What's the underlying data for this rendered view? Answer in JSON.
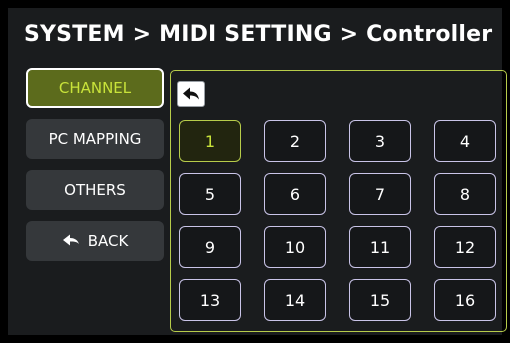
{
  "header": {
    "title": "SYSTEM  >  MIDI SETTING > Controller"
  },
  "sidebar": {
    "items": [
      {
        "label": "CHANNEL",
        "active": true
      },
      {
        "label": "PC MAPPING",
        "active": false
      },
      {
        "label": "OTHERS",
        "active": false
      },
      {
        "label": "BACK",
        "active": false,
        "icon": "back-arrow-icon"
      }
    ]
  },
  "panel": {
    "return_icon": "return-arrow-icon",
    "selected_channel": "1",
    "channels": [
      "1",
      "2",
      "3",
      "4",
      "5",
      "6",
      "7",
      "8",
      "9",
      "10",
      "11",
      "12",
      "13",
      "14",
      "15",
      "16"
    ]
  },
  "colors": {
    "accent": "#c8e33a",
    "panel_border": "#b7cc4a",
    "button_border": "#c9c4e8",
    "sidebar_button": "#35383b"
  }
}
